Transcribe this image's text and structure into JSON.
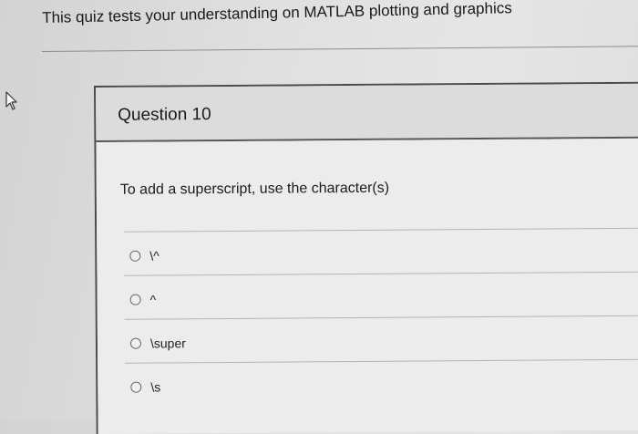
{
  "quiz": {
    "intro": "This quiz tests your understanding on MATLAB plotting and graphics"
  },
  "question": {
    "title": "Question 10",
    "prompt": "To add a superscript, use the character(s)",
    "options": [
      {
        "label": "\\^"
      },
      {
        "label": "^"
      },
      {
        "label": "\\super"
      },
      {
        "label": "\\s"
      }
    ]
  }
}
